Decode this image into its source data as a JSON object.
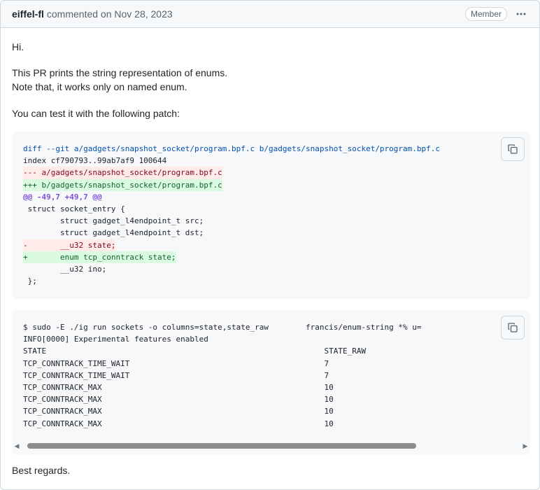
{
  "header": {
    "author": "eiffel-fl",
    "meta": "commented on Nov 28, 2023",
    "badge": "Member"
  },
  "body": {
    "greeting": "Hi.",
    "desc_line1": "This PR prints the string representation of enums.",
    "desc_line2": "Note that, it works only on named enum.",
    "test_intro": "You can test it with the following patch:",
    "closing": "Best regards."
  },
  "code1": {
    "lines": [
      {
        "type": "hdr",
        "text": "diff --git a/gadgets/snapshot_socket/program.bpf.c b/gadgets/snapshot_socket/program.bpf.c"
      },
      {
        "type": "plain",
        "text": "index cf790793..99ab7af9 100644"
      },
      {
        "type": "rem",
        "text": "--- a/gadgets/snapshot_socket/program.bpf.c"
      },
      {
        "type": "add",
        "text": "+++ b/gadgets/snapshot_socket/program.bpf.c"
      },
      {
        "type": "hunk",
        "text": "@@ -49,7 +49,7 @@"
      },
      {
        "type": "plain",
        "text": " struct socket_entry {"
      },
      {
        "type": "plain",
        "text": "        struct gadget_l4endpoint_t src;"
      },
      {
        "type": "plain",
        "text": "        struct gadget_l4endpoint_t dst;"
      },
      {
        "type": "rem",
        "text": "-       __u32 state;"
      },
      {
        "type": "add",
        "text": "+       enum tcp_conntrack state;"
      },
      {
        "type": "plain",
        "text": "        __u32 ino;"
      },
      {
        "type": "plain",
        "text": " };"
      }
    ]
  },
  "code2": {
    "lines": [
      "$ sudo -E ./ig run sockets -o columns=state,state_raw        francis/enum-string *% u=",
      "INFO[0000] Experimental features enabled",
      "STATE                                                            STATE_RAW",
      "TCP_CONNTRACK_TIME_WAIT                                          7",
      "TCP_CONNTRACK_TIME_WAIT                                          7",
      "TCP_CONNTRACK_MAX                                                10",
      "TCP_CONNTRACK_MAX                                                10",
      "TCP_CONNTRACK_MAX                                                10",
      "TCP_CONNTRACK_MAX                                                10"
    ]
  },
  "icons": {
    "copy": "copy-icon",
    "kebab": "kebab-horizontal-icon"
  },
  "colors": {
    "removed_bg": "#ffebe9",
    "added_bg": "#dafbe1",
    "hunk": "#8250df",
    "header_bg": "#f6f8fa"
  }
}
